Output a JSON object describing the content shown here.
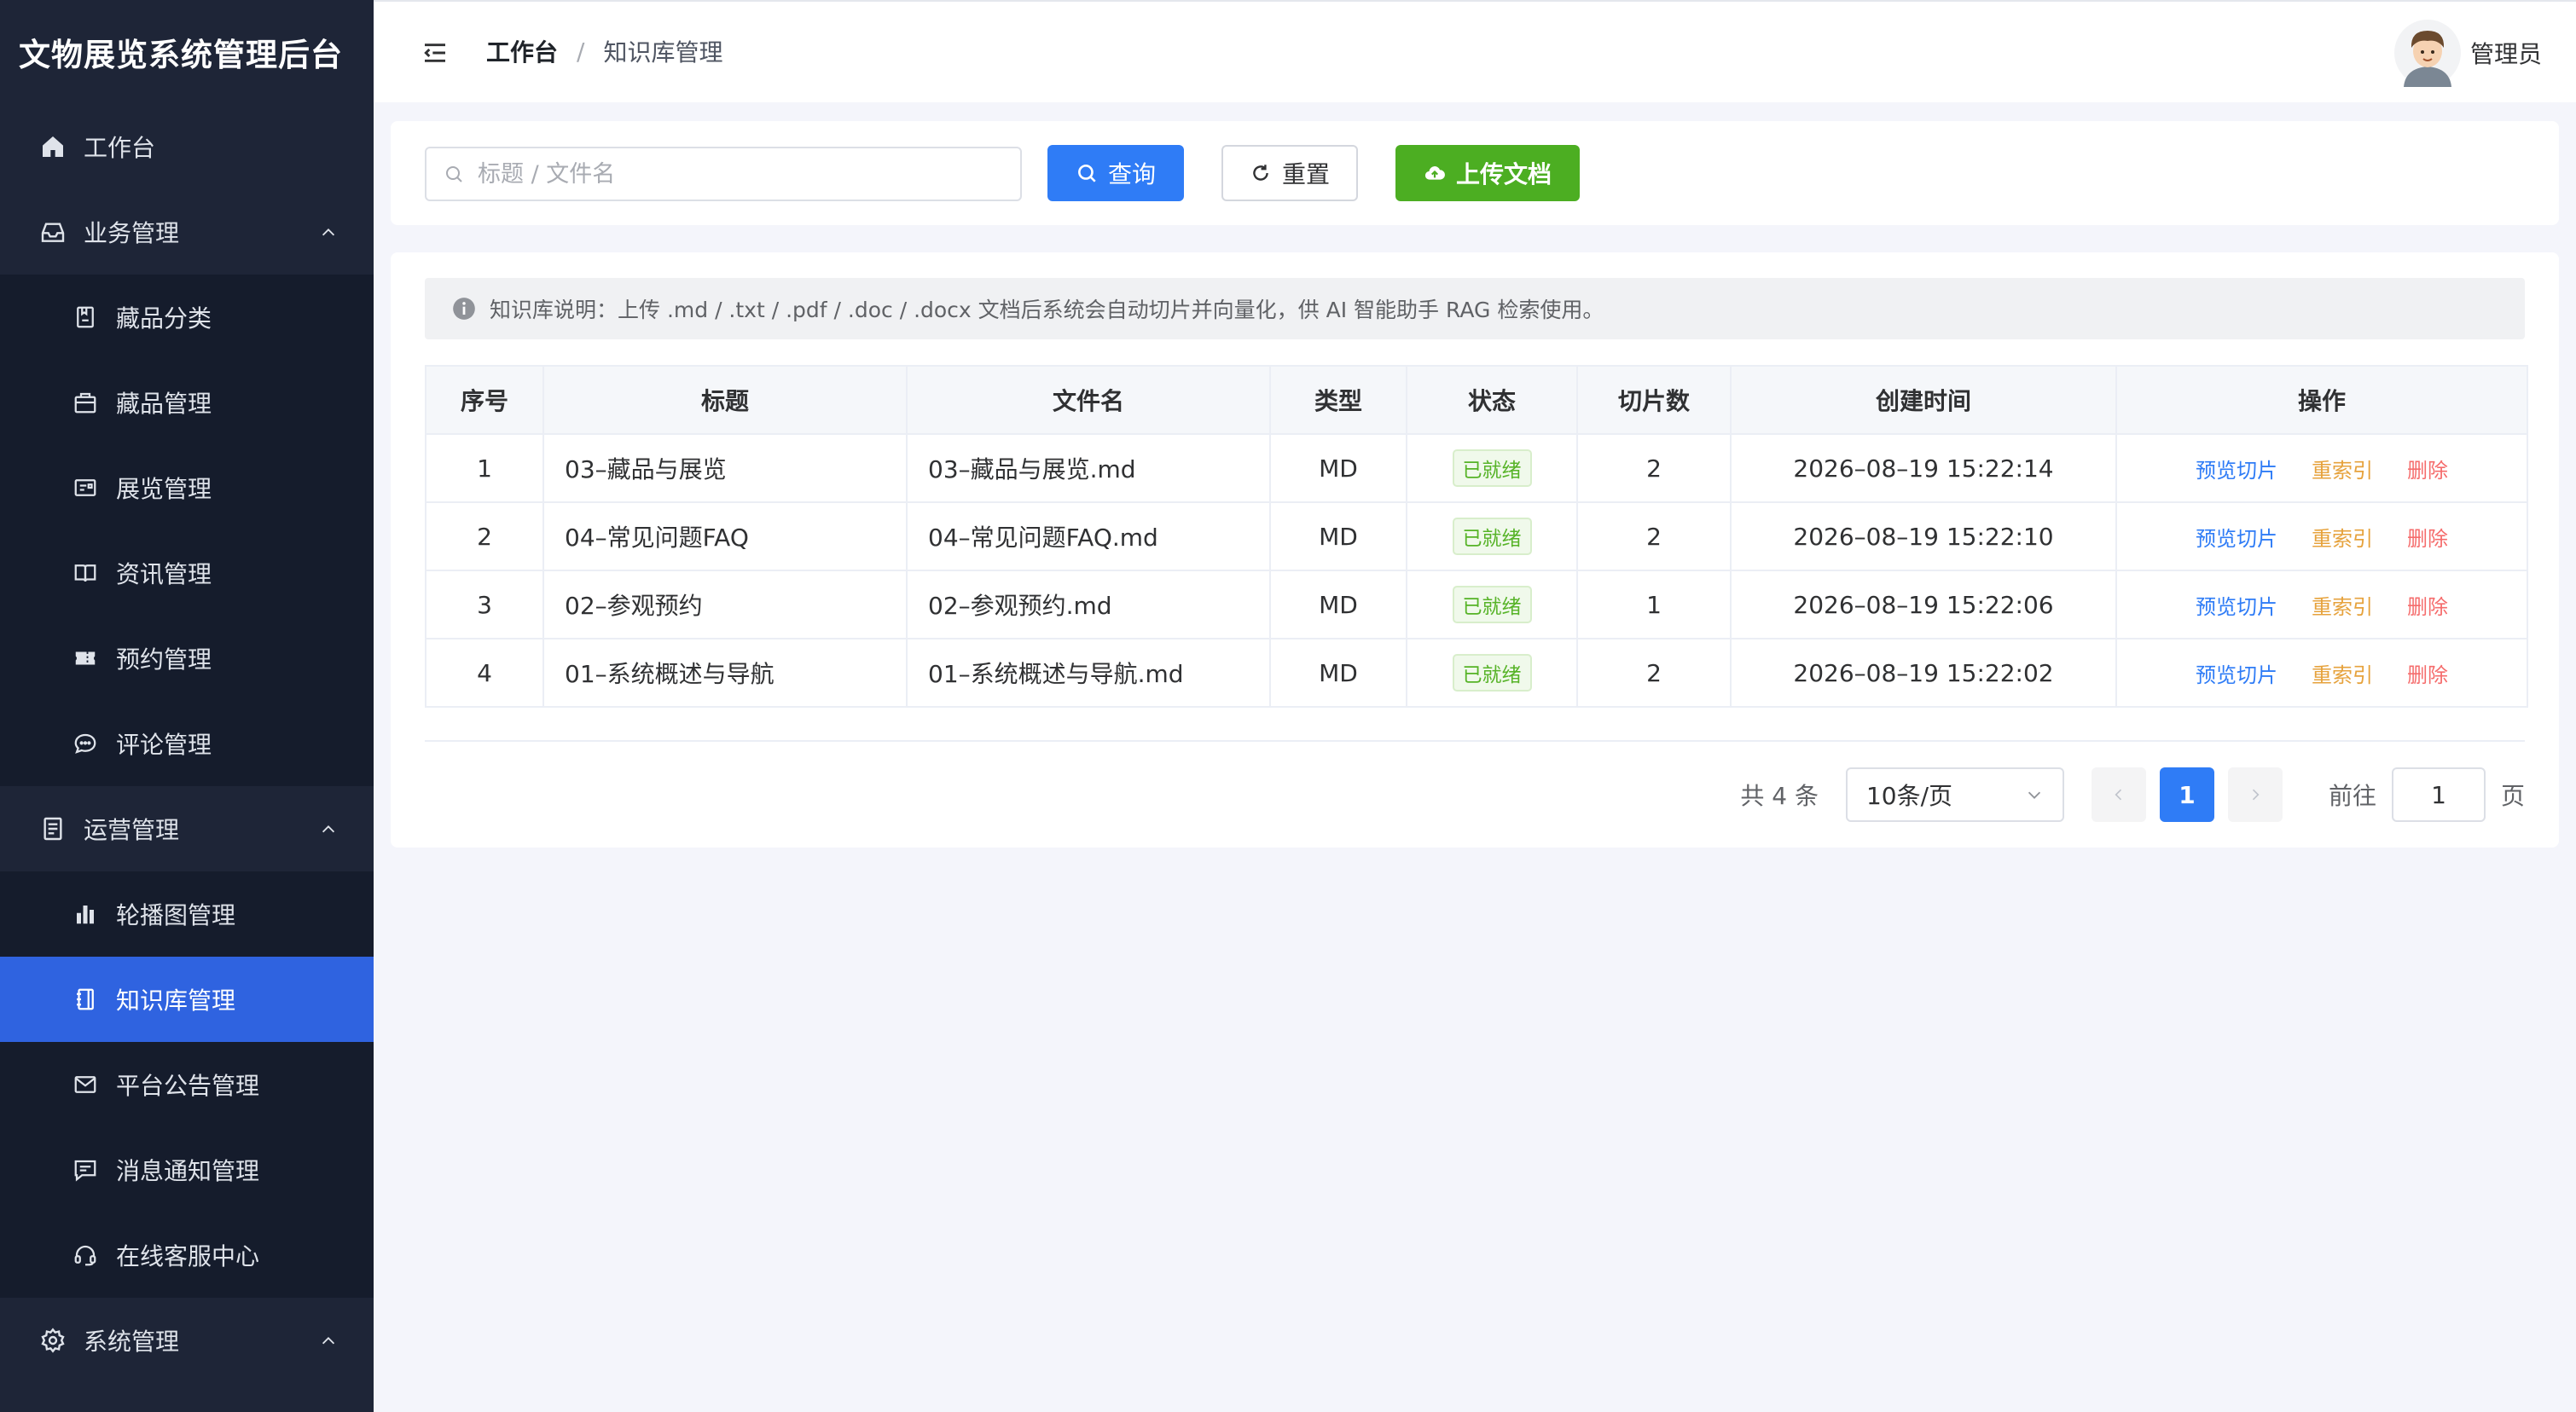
{
  "app": {
    "title": "文物展览系统管理后台"
  },
  "sidebar": {
    "items": [
      {
        "label": "工作台",
        "icon": "home-icon"
      },
      {
        "label": "业务管理",
        "icon": "inbox-icon",
        "expanded": true
      },
      {
        "label": "藏品分类",
        "icon": "album-icon"
      },
      {
        "label": "藏品管理",
        "icon": "box-icon"
      },
      {
        "label": "展览管理",
        "icon": "postcard-icon"
      },
      {
        "label": "资讯管理",
        "icon": "reading-icon"
      },
      {
        "label": "预约管理",
        "icon": "ticket-icon"
      },
      {
        "label": "评论管理",
        "icon": "chat-icon"
      },
      {
        "label": "运营管理",
        "icon": "document-icon",
        "expanded": true
      },
      {
        "label": "轮播图管理",
        "icon": "histogram-icon"
      },
      {
        "label": "知识库管理",
        "icon": "notebook-icon",
        "active": true
      },
      {
        "label": "平台公告管理",
        "icon": "message-icon"
      },
      {
        "label": "消息通知管理",
        "icon": "chat-square-icon"
      },
      {
        "label": "在线客服中心",
        "icon": "headset-icon"
      },
      {
        "label": "系统管理",
        "icon": "setting-icon",
        "expanded": true
      }
    ]
  },
  "header": {
    "breadcrumb_home": "工作台",
    "breadcrumb_sep": "/",
    "breadcrumb_current": "知识库管理",
    "user_name": "管理员"
  },
  "search": {
    "placeholder": "标题 / 文件名",
    "value": "",
    "query_label": "查询",
    "reset_label": "重置",
    "upload_label": "上传文档"
  },
  "notice": "知识库说明：上传 .md / .txt / .pdf / .doc / .docx 文档后系统会自动切片并向量化，供 AI 智能助手 RAG 检索使用。",
  "table": {
    "columns": [
      "序号",
      "标题",
      "文件名",
      "类型",
      "状态",
      "切片数",
      "创建时间",
      "操作"
    ],
    "rows": [
      {
        "index": "1",
        "title": "03–藏品与展览",
        "filename": "03–藏品与展览.md",
        "type": "MD",
        "status": "已就绪",
        "chunks": "2",
        "created": "2026–08–19 15:22:14"
      },
      {
        "index": "2",
        "title": "04–常见问题FAQ",
        "filename": "04–常见问题FAQ.md",
        "type": "MD",
        "status": "已就绪",
        "chunks": "2",
        "created": "2026–08–19 15:22:10"
      },
      {
        "index": "3",
        "title": "02–参观预约",
        "filename": "02–参观预约.md",
        "type": "MD",
        "status": "已就绪",
        "chunks": "1",
        "created": "2026–08–19 15:22:06"
      },
      {
        "index": "4",
        "title": "01–系统概述与导航",
        "filename": "01–系统概述与导航.md",
        "type": "MD",
        "status": "已就绪",
        "chunks": "2",
        "created": "2026–08–19 15:22:02"
      }
    ],
    "actions": {
      "preview": "预览切片",
      "reindex": "重索引",
      "delete": "删除"
    }
  },
  "pagination": {
    "total_text": "共 4 条",
    "page_size": "10条/页",
    "prev_icon": "chevron-left-icon",
    "next_icon": "chevron-right-icon",
    "current_page": "1",
    "goto_label": "前往",
    "goto_value": "1",
    "page_suffix": "页"
  },
  "colors": {
    "sidebar_bg": "#1e2537",
    "sidebar_active": "#2f63e0",
    "primary": "#2f7cf6",
    "success": "#4cae22",
    "warning": "#e6a23c",
    "danger": "#f56c6c"
  }
}
